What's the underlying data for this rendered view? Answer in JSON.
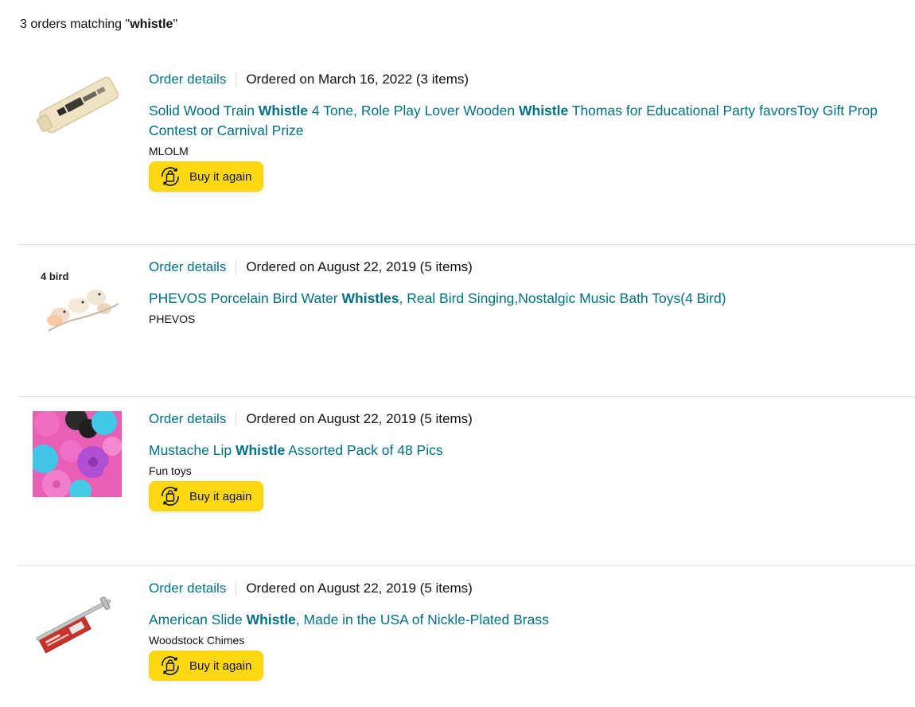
{
  "search": {
    "count_text": "3 orders matching \"",
    "query": "whistle",
    "suffix": "\""
  },
  "orders": [
    {
      "details_label": "Order details",
      "ordered_on": "Ordered on March 16, 2022 (3 items)",
      "title_parts": [
        "Solid Wood Train ",
        "Whistle",
        " 4 Tone, Role Play Lover Wooden ",
        "Whistle",
        " Thomas for Educational Party favorsToy Gift Prop Contest or Carnival Prize"
      ],
      "brand": "MLOLM",
      "buy_again": "Buy it again"
    },
    {
      "details_label": "Order details",
      "ordered_on": "Ordered on August 22, 2019 (5 items)",
      "title_parts": [
        "PHEVOS Porcelain Bird Water ",
        "Whistles",
        ", Real Bird Singing,Nostalgic Music Bath Toys(4 Bird)"
      ],
      "brand": "PHEVOS",
      "image_label": "4 bird"
    },
    {
      "details_label": "Order details",
      "ordered_on": "Ordered on August 22, 2019 (5 items)",
      "title_parts": [
        "Mustache Lip ",
        "Whistle",
        " Assorted Pack of 48 Pics"
      ],
      "brand": "Fun toys",
      "buy_again": "Buy it again"
    },
    {
      "details_label": "Order details",
      "ordered_on": "Ordered on August 22, 2019 (5 items)",
      "title_parts": [
        "American Slide ",
        "Whistle",
        ", Made in the USA of Nickle-Plated Brass"
      ],
      "brand": "Woodstock Chimes",
      "buy_again": "Buy it again"
    }
  ],
  "colors": {
    "link": "#007185",
    "button": "#ffd814",
    "divider": "#e3e6e6"
  },
  "icons": {
    "buy_again": "reorder-bag-icon"
  }
}
